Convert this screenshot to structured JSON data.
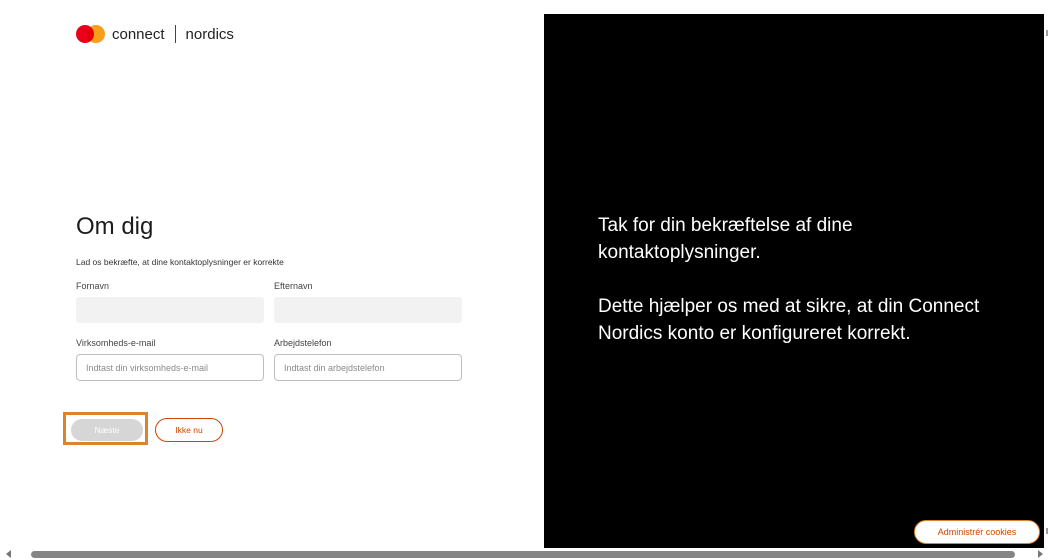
{
  "brand": {
    "logo_icon": "mastercard-circles-icon",
    "word1": "connect",
    "word2": "nordics",
    "colors": {
      "red": "#eb001b",
      "orange": "#f79e1b"
    }
  },
  "form": {
    "title": "Om dig",
    "subtitle": "Lad os bekræfte, at dine kontaktoplysninger er korrekte",
    "first_name_label": "Fornavn",
    "first_name_value": "",
    "last_name_label": "Efternavn",
    "last_name_value": "",
    "email_label": "Virksomheds-e-mail",
    "email_placeholder": "Indtast din virksomheds-e-mail",
    "phone_label": "Arbejdstelefon",
    "phone_placeholder": "Indtast din arbejdstelefon",
    "next_label": "Næste",
    "skip_label": "Ikke nu"
  },
  "info_panel": {
    "paragraph1": "Tak for din bekræftelse af dine kontaktoplysninger.",
    "paragraph2": "Dette hjælper os med at sikre, at din Connect Nordics konto er konfigureret korrekt."
  },
  "cookies": {
    "button_label": "Administrér cookies"
  },
  "colors": {
    "accent": "#cf4500",
    "highlight": "#e0812c",
    "panel_bg": "#000000",
    "disabled_button": "#d6d6d6"
  }
}
